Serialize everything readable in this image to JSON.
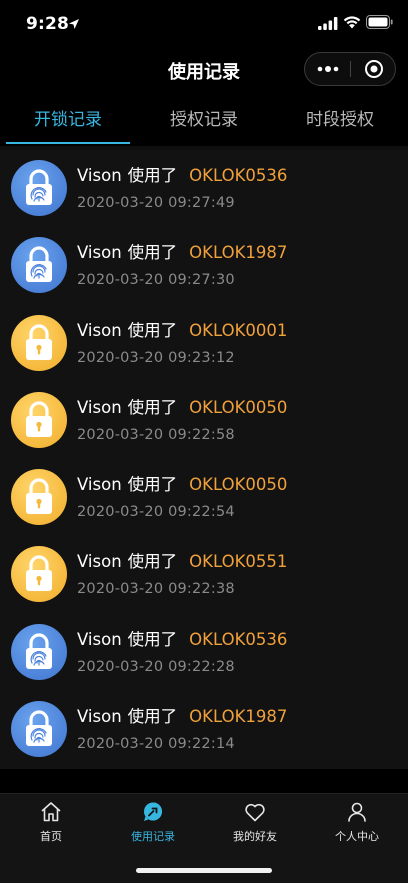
{
  "status_bar": {
    "time": "9:28",
    "icons": [
      "location-arrow-icon",
      "signal-icon",
      "wifi-icon",
      "battery-icon"
    ]
  },
  "nav": {
    "title": "使用记录",
    "capsule_icons": [
      "more-dots-icon",
      "close-target-icon"
    ]
  },
  "tabs": [
    {
      "label": "开锁记录",
      "active": true
    },
    {
      "label": "授权记录",
      "active": false
    },
    {
      "label": "时段授权",
      "active": false
    }
  ],
  "records": [
    {
      "user": "Vison",
      "action": "使用了",
      "lock": "OKLOK0536",
      "time": "2020-03-20 09:27:49",
      "icon": "fingerprint-icon",
      "color": "#4a82dc"
    },
    {
      "user": "Vison",
      "action": "使用了",
      "lock": "OKLOK1987",
      "time": "2020-03-20 09:27:30",
      "icon": "fingerprint-icon",
      "color": "#4a82dc"
    },
    {
      "user": "Vison",
      "action": "使用了",
      "lock": "OKLOK0001",
      "time": "2020-03-20 09:23:12",
      "icon": "padlock-icon",
      "color": "#f5b93d"
    },
    {
      "user": "Vison",
      "action": "使用了",
      "lock": "OKLOK0050",
      "time": "2020-03-20 09:22:58",
      "icon": "padlock-icon",
      "color": "#f5b93d"
    },
    {
      "user": "Vison",
      "action": "使用了",
      "lock": "OKLOK0050",
      "time": "2020-03-20 09:22:54",
      "icon": "padlock-icon",
      "color": "#f5b93d"
    },
    {
      "user": "Vison",
      "action": "使用了",
      "lock": "OKLOK0551",
      "time": "2020-03-20 09:22:38",
      "icon": "padlock-icon",
      "color": "#f5b93d"
    },
    {
      "user": "Vison",
      "action": "使用了",
      "lock": "OKLOK0536",
      "time": "2020-03-20 09:22:28",
      "icon": "fingerprint-icon",
      "color": "#4a82dc"
    },
    {
      "user": "Vison",
      "action": "使用了",
      "lock": "OKLOK1987",
      "time": "2020-03-20 09:22:14",
      "icon": "fingerprint-icon",
      "color": "#4a82dc"
    }
  ],
  "tabbar": [
    {
      "label": "首页",
      "icon": "home-icon",
      "active": false
    },
    {
      "label": "使用记录",
      "icon": "records-icon",
      "active": true
    },
    {
      "label": "我的好友",
      "icon": "heart-icon",
      "active": false
    },
    {
      "label": "个人中心",
      "icon": "person-icon",
      "active": false
    }
  ],
  "colors": {
    "accent": "#37b6e0",
    "lock_id": "#f0a13c",
    "timestamp": "#8a8a8a",
    "list_bg": "#121212"
  }
}
